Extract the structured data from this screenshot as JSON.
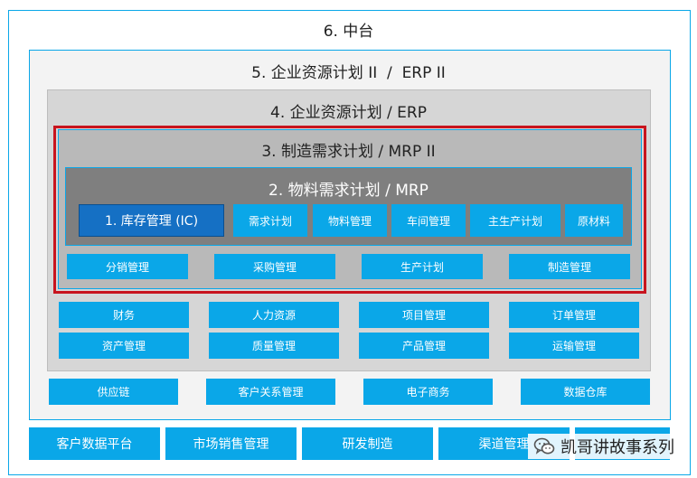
{
  "levels": {
    "l6": {
      "title": "6. 中台"
    },
    "l5": {
      "title": "5. 企业资源计划 II  /  ERP II"
    },
    "l4": {
      "title": "4. 企业资源计划 / ERP"
    },
    "l3": {
      "title": "3. 制造需求计划 / MRP II"
    },
    "l2": {
      "title": "2. 物料需求计划 / MRP"
    },
    "l1": {
      "title": "1. 库存管理 (IC)"
    }
  },
  "mrp_modules": [
    "需求计划",
    "物料管理",
    "车间管理",
    "主生产计划",
    "原材料"
  ],
  "mrp2_modules": [
    "分销管理",
    "采购管理",
    "生产计划",
    "制造管理"
  ],
  "erp_modules_row1": [
    "财务",
    "人力资源",
    "项目管理",
    "订单管理"
  ],
  "erp_modules_row2": [
    "资产管理",
    "质量管理",
    "产品管理",
    "运输管理"
  ],
  "erp2_modules": [
    "供应链",
    "客户关系管理",
    "电子商务",
    "数据仓库"
  ],
  "platform_modules": [
    "客户数据平台",
    "市场销售管理",
    "研发制造",
    "渠道管理",
    ""
  ],
  "watermark": {
    "text": "凯哥讲故事系列",
    "icon": "wechat-icon"
  },
  "colors": {
    "accent_blue": "#0aa7e8",
    "dark_blue": "#1570c4",
    "highlight_red": "#c8141e",
    "gray_level4": "#d6d6d6",
    "gray_level3": "#b9b9b9",
    "gray_level2": "#7f7f7f"
  }
}
